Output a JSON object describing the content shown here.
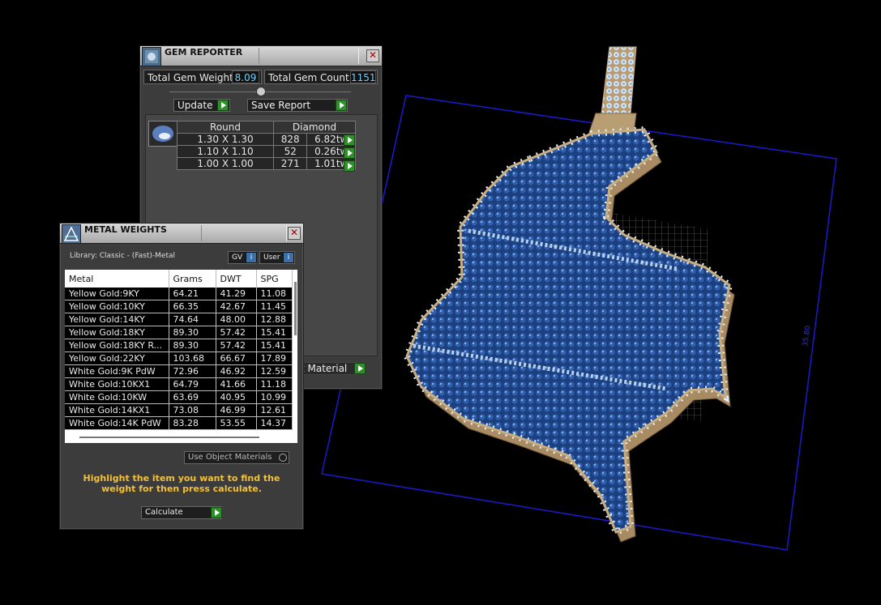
{
  "gem_reporter": {
    "title": "GEM REPORTER",
    "total_weight_label": "Total Gem Weight",
    "total_weight_value": "8.09",
    "total_count_label": "Total Gem Count",
    "total_count_value": "1151",
    "update_label": "Update",
    "save_report_label": "Save Report",
    "material_label": "t Material",
    "table": {
      "headers": [
        "Round",
        "Diamond"
      ],
      "rows": [
        {
          "size": "1.30 X 1.30",
          "count": "828",
          "weight": "6.82tw"
        },
        {
          "size": "1.10 X 1.10",
          "count": "52",
          "weight": "0.26tw"
        },
        {
          "size": "1.00 X 1.00",
          "count": "271",
          "weight": "1.01tw"
        }
      ]
    }
  },
  "metal_weights": {
    "title": "METAL WEIGHTS",
    "library": "Library: Classic - (Fast)-Metal",
    "gv_label": "GV",
    "user_label": "User",
    "columns": [
      "Metal",
      "Grams",
      "DWT",
      "SPG"
    ],
    "rows": [
      {
        "metal": "Yellow Gold:9KY",
        "grams": "64.21",
        "dwt": "41.29",
        "spg": "11.08"
      },
      {
        "metal": "Yellow Gold:10KY",
        "grams": "66.35",
        "dwt": "42.67",
        "spg": "11.45"
      },
      {
        "metal": "Yellow Gold:14KY",
        "grams": "74.64",
        "dwt": "48.00",
        "spg": "12.88"
      },
      {
        "metal": "Yellow Gold:18KY",
        "grams": "89.30",
        "dwt": "57.42",
        "spg": "15.41"
      },
      {
        "metal": "Yellow Gold:18KY R...",
        "grams": "89.30",
        "dwt": "57.42",
        "spg": "15.41"
      },
      {
        "metal": "Yellow Gold:22KY",
        "grams": "103.68",
        "dwt": "66.67",
        "spg": "17.89"
      },
      {
        "metal": "White Gold:9K PdW",
        "grams": "72.96",
        "dwt": "46.92",
        "spg": "12.59"
      },
      {
        "metal": "White Gold:10KX1",
        "grams": "64.79",
        "dwt": "41.66",
        "spg": "11.18"
      },
      {
        "metal": "White Gold:10KW",
        "grams": "63.69",
        "dwt": "40.95",
        "spg": "10.99"
      },
      {
        "metal": "White Gold:14KX1",
        "grams": "73.08",
        "dwt": "46.99",
        "spg": "12.61"
      },
      {
        "metal": "White Gold:14K PdW",
        "grams": "83.28",
        "dwt": "53.55",
        "spg": "14.37"
      }
    ],
    "use_object_materials": "Use Object Materials",
    "hint": "Highlight the item you want to find the weight for then press calculate.",
    "calculate_label": "Calculate"
  },
  "viewport": {
    "dimension_label": "35.80",
    "colors": {
      "gem": "#2d5aa8",
      "gem_edge": "#9fc6ea",
      "metal": "#c3a67a",
      "bbox": "#1818c8"
    }
  }
}
